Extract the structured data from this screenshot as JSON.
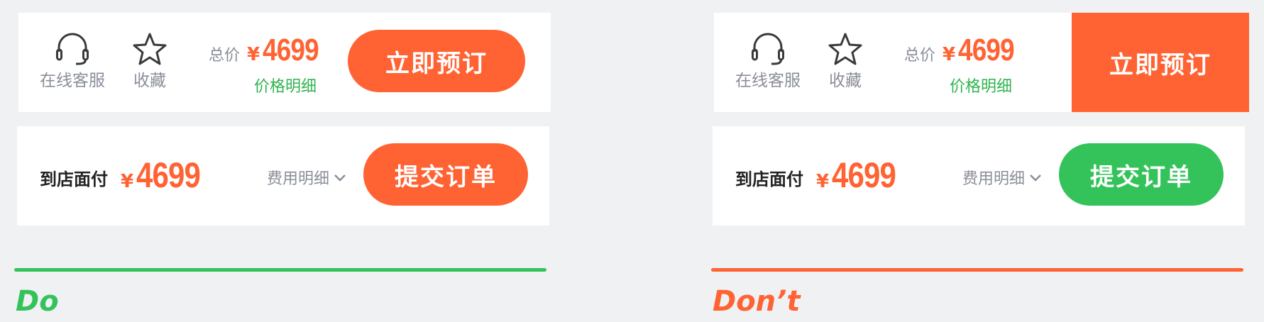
{
  "colors": {
    "orange": "#ff6333",
    "green": "#34c35a",
    "green_text": "#2fb44f",
    "gray_text": "#8a8e99",
    "background": "#f0f1f3"
  },
  "icons": {
    "service": "headset-icon",
    "favorite": "star-icon",
    "dropdown": "chevron-down-icon"
  },
  "do": {
    "label": "Do",
    "row1": {
      "service_label": "在线客服",
      "favorite_label": "收藏",
      "price_prefix": "总价",
      "currency": "¥",
      "price": "4699",
      "price_detail": "价格明细",
      "book_button": "立即预订"
    },
    "row2": {
      "pay_label": "到店面付",
      "currency": "¥",
      "price": "4699",
      "fee_detail": "费用明细",
      "submit_button": "提交订单"
    }
  },
  "dont": {
    "label": "Don’t",
    "row1": {
      "service_label": "在线客服",
      "favorite_label": "收藏",
      "price_prefix": "总价",
      "currency": "¥",
      "price": "4699",
      "price_detail": "价格明细",
      "book_button": "立即预订"
    },
    "row2": {
      "pay_label": "到店面付",
      "currency": "¥",
      "price": "4699",
      "fee_detail": "费用明细",
      "submit_button": "提交订单"
    }
  }
}
